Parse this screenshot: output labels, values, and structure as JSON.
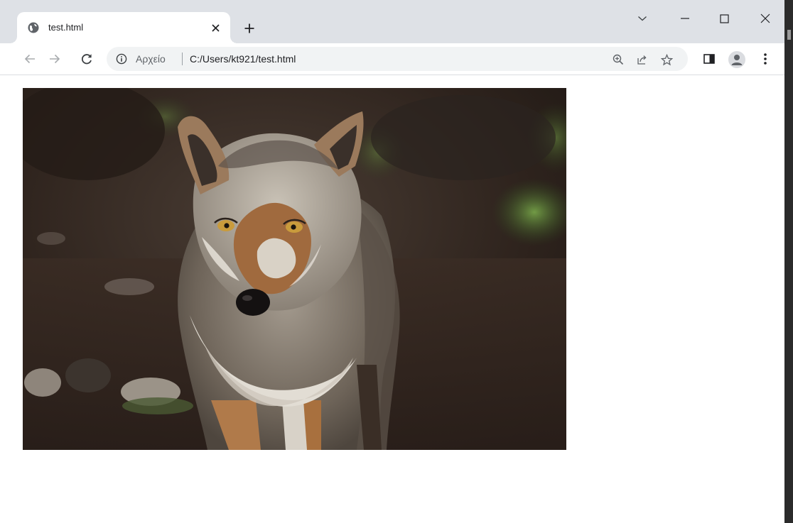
{
  "browser": {
    "tab": {
      "title": "test.html",
      "favicon": "globe-icon",
      "close_icon": "close-icon"
    },
    "new_tab_icon": "plus-icon",
    "window_controls": [
      "chevron-down-icon",
      "minimize-icon",
      "maximize-icon",
      "close-icon"
    ],
    "toolbar": {
      "back_icon": "arrow-left-icon",
      "forward_icon": "arrow-right-icon",
      "reload_icon": "reload-icon",
      "omnibox": {
        "info_icon": "info-icon",
        "scheme_label": "Αρχείο",
        "url": "C:/Users/kt921/test.html",
        "zoom_icon": "zoom-in-icon",
        "share_icon": "share-icon",
        "bookmark_icon": "star-icon"
      },
      "side_panel_icon": "side-panel-icon",
      "profile_icon": "profile-icon",
      "menu_icon": "kebab-menu-icon"
    }
  },
  "page": {
    "image": {
      "subject": "wolf-photo",
      "colors": {
        "fur_light": "#c9c2b6",
        "fur_dark": "#6e6459",
        "ground": "#3a2c24",
        "foliage": "#5f8a3a"
      }
    }
  }
}
